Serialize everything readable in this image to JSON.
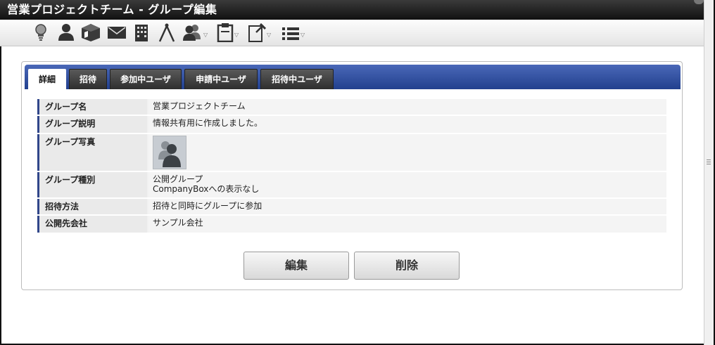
{
  "window": {
    "title": "営業プロジェクトチーム - グループ編集"
  },
  "toolbar": {
    "icons": [
      "lightbulb-icon",
      "user-icon",
      "box-icon",
      "mail-icon",
      "building-icon",
      "compass-icon",
      "group-icon",
      "clipboard-icon",
      "pin-note-icon",
      "list-icon"
    ],
    "caret": "▽"
  },
  "tabs": [
    {
      "label": "詳細",
      "active": true
    },
    {
      "label": "招待",
      "active": false
    },
    {
      "label": "参加中ユーザ",
      "active": false
    },
    {
      "label": "申請中ユーザ",
      "active": false
    },
    {
      "label": "招待中ユーザ",
      "active": false
    }
  ],
  "detail": {
    "group_name": {
      "label": "グループ名",
      "value": "営業プロジェクトチーム"
    },
    "group_description": {
      "label": "グループ説明",
      "value": "情報共有用に作成しました。"
    },
    "group_photo": {
      "label": "グループ写真"
    },
    "group_type": {
      "label": "グループ種別",
      "value_line1": "公開グループ",
      "value_line2": "CompanyBoxへの表示なし"
    },
    "invite_method": {
      "label": "招待方法",
      "value": "招待と同時にグループに参加"
    },
    "public_company": {
      "label": "公開先会社",
      "value": "サンプル会社"
    }
  },
  "buttons": {
    "edit": "編集",
    "delete": "削除"
  },
  "colors": {
    "tab_bar": "#2a4899",
    "label_accent": "#30468a",
    "title_bar": "#1a1a1a"
  }
}
